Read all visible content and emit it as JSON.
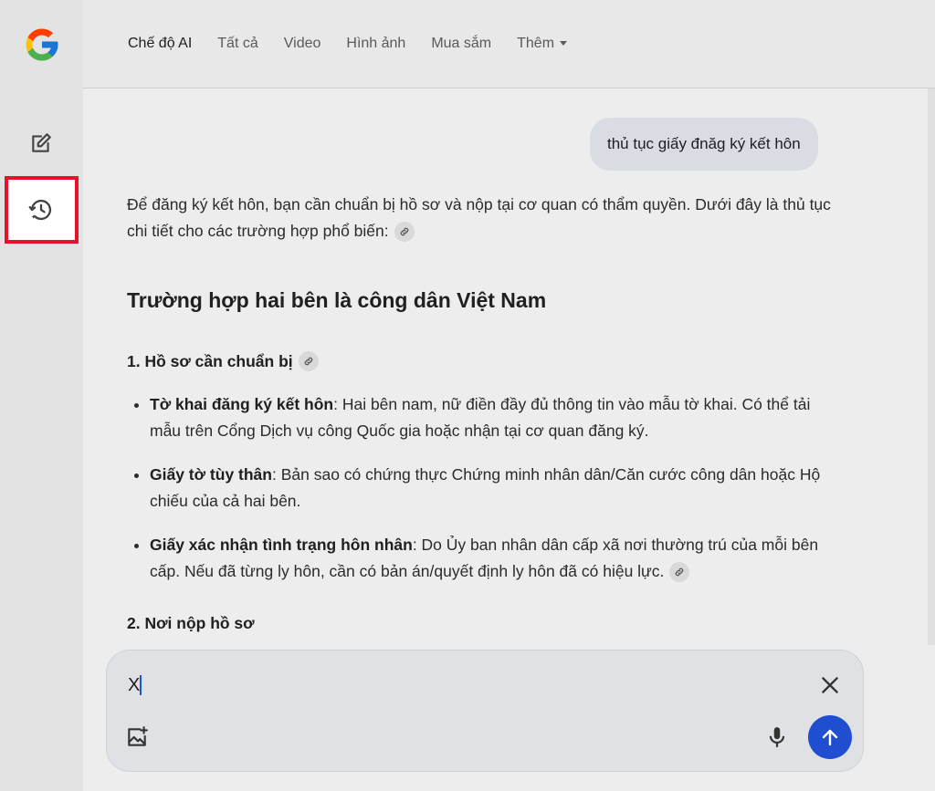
{
  "tabs": [
    {
      "label": "Chế độ AI"
    },
    {
      "label": "Tất cả"
    },
    {
      "label": "Video"
    },
    {
      "label": "Hình ảnh"
    },
    {
      "label": "Mua sắm"
    },
    {
      "label": "Thêm"
    }
  ],
  "user_query": "thủ tục giấy đnăg ký kết hôn",
  "answer": {
    "intro": "Để đăng ký kết hôn, bạn cần chuẩn bị hồ sơ và nộp tại cơ quan có thẩm quyền. Dưới đây là thủ tục chi tiết cho các trường hợp phổ biến:",
    "section_title": "Trường hợp hai bên là công dân Việt Nam",
    "sub1_title": "1. Hồ sơ cần chuẩn bị",
    "items": [
      {
        "term": "Tờ khai đăng ký kết hôn",
        "text": ": Hai bên nam, nữ điền đầy đủ thông tin vào mẫu tờ khai. Có thể tải mẫu trên Cổng Dịch vụ công Quốc gia hoặc nhận tại cơ quan đăng ký."
      },
      {
        "term": "Giấy tờ tùy thân",
        "text": ": Bản sao có chứng thực Chứng minh nhân dân/Căn cước công dân hoặc Hộ chiếu của cả hai bên."
      },
      {
        "term": "Giấy xác nhận tình trạng hôn nhân",
        "text": ": Do Ủy ban nhân dân cấp xã nơi thường trú của mỗi bên cấp. Nếu đã từng ly hôn, cần có bản án/quyết định ly hôn đã có hiệu lực."
      }
    ],
    "sub2_title": "2. Nơi nộp hồ sơ"
  },
  "composer": {
    "value": "X"
  },
  "colors": {
    "accent": "#1f4fd0",
    "highlight_border": "#e8102c"
  },
  "icons": {
    "logo": "google-logo",
    "new_chat": "edit-icon",
    "history": "history-icon",
    "link": "link-icon",
    "close": "close-icon",
    "add_image": "add-image-icon",
    "mic": "mic-icon",
    "send": "arrow-up-icon"
  }
}
